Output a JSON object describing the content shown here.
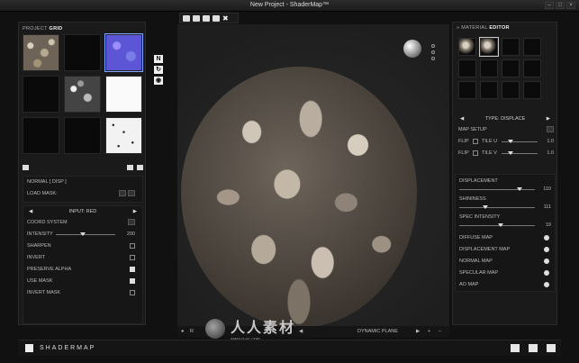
{
  "window": {
    "title": "New Project - ShaderMap™",
    "controls": [
      "–",
      "□",
      "×"
    ]
  },
  "left_panel": {
    "header_prefix": "PROJECT",
    "header_bold": "GRID",
    "map_settings": {
      "map_name": "NORMAL [ DISP ]",
      "load_mask_label": "LOAD MASK:",
      "input_label": "INPUT: RED",
      "rows": [
        {
          "label": "COORD SYSTEM",
          "control": "button"
        },
        {
          "label": "INTENSITY",
          "control": "slider",
          "value": "200",
          "level": 0.45
        },
        {
          "label": "SHARPEN",
          "control": "checkbox",
          "checked": false
        },
        {
          "label": "INVERT",
          "control": "checkbox",
          "checked": false
        },
        {
          "label": "PRESERVE ALPHA",
          "control": "checkbox",
          "checked": true
        },
        {
          "label": "USE MASK",
          "control": "checkbox",
          "checked": true
        },
        {
          "label": "INVERT MASK",
          "control": "checkbox",
          "checked": false
        }
      ]
    }
  },
  "right_panel": {
    "header_prefix": "MATERIAL",
    "header_bold": "EDITOR",
    "type_label": "TYPE: DISPLACE",
    "map_setup_label": "MAP SETUP",
    "flip_u": {
      "flip": "FLIP",
      "tile": "TILE U",
      "value": "1.0",
      "level": 0.25
    },
    "flip_v": {
      "flip": "FLIP",
      "tile": "TILE V",
      "value": "1.0",
      "level": 0.25
    },
    "params": [
      {
        "label": "DISPLACEMENT",
        "value": "110",
        "level": 0.8
      },
      {
        "label": "SHININESS",
        "value": "111",
        "level": 0.35
      },
      {
        "label": "SPEC INTENSITY",
        "value": "19",
        "level": 0.55
      }
    ],
    "maps": [
      {
        "label": "DIFFUSE MAP"
      },
      {
        "label": "DISPLACEMENT MAP"
      },
      {
        "label": "NORMAL MAP"
      },
      {
        "label": "SPECULAR MAP"
      },
      {
        "label": "AO MAP"
      }
    ]
  },
  "viewport": {
    "bottom_labels": {
      "mode": "R",
      "plane": "DYNAMIC PLANE",
      "plus": "+",
      "minus": "–"
    }
  },
  "watermark": {
    "text": "人人素材",
    "url": "www.rr-sc.com"
  },
  "bottombar": {
    "brand": "SHADERMAP"
  }
}
